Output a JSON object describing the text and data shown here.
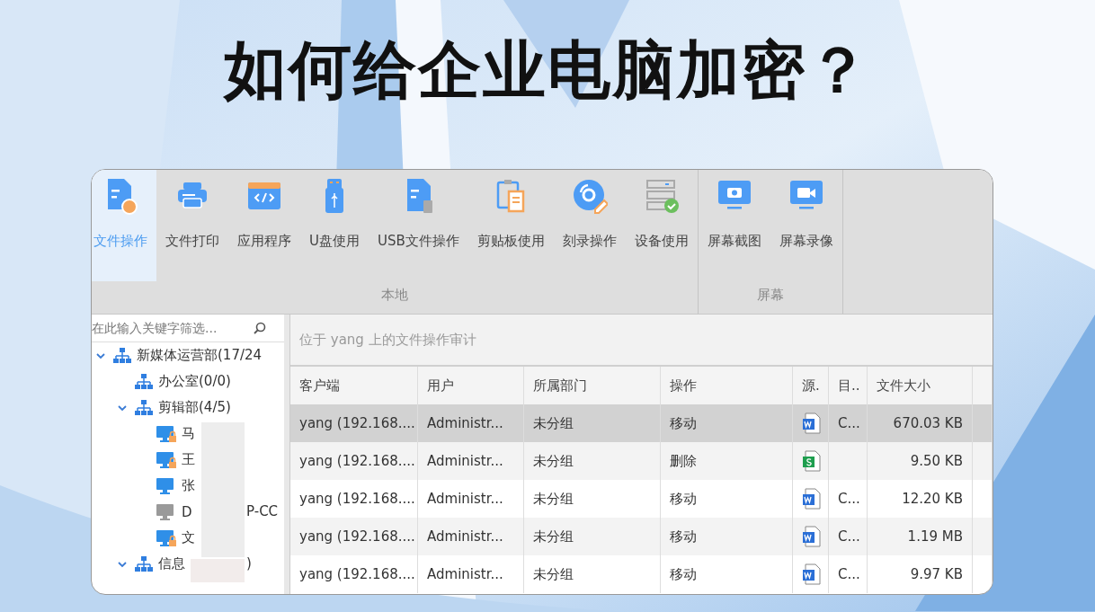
{
  "headline": "如何给企业电脑加密？",
  "toolbar": {
    "groups": [
      {
        "label": "本地",
        "items": [
          {
            "label": "文件操作",
            "kind": "file-op",
            "selected": true
          },
          {
            "label": "文件打印",
            "kind": "print",
            "selected": false
          },
          {
            "label": "应用程序",
            "kind": "app",
            "selected": false
          },
          {
            "label": "U盘使用",
            "kind": "usb",
            "selected": false
          },
          {
            "label": "USB文件操作",
            "kind": "usb-file",
            "selected": false
          },
          {
            "label": "剪贴板使用",
            "kind": "clipboard",
            "selected": false
          },
          {
            "label": "刻录操作",
            "kind": "disc",
            "selected": false
          },
          {
            "label": "设备使用",
            "kind": "device",
            "selected": false
          }
        ]
      },
      {
        "label": "屏幕",
        "items": [
          {
            "label": "屏幕截图",
            "kind": "screenshot",
            "selected": false
          },
          {
            "label": "屏幕录像",
            "kind": "record",
            "selected": false
          }
        ]
      }
    ]
  },
  "sidebar": {
    "search": {
      "placeholder": "在此输入关键字筛选..."
    },
    "tree": [
      {
        "kind": "group",
        "label": "新媒体运营部(17/24",
        "expanded": true,
        "children": [
          {
            "kind": "group",
            "label": "办公室(0/0)"
          },
          {
            "kind": "group",
            "label": "剪辑部(4/5)",
            "expanded": true,
            "children": [
              {
                "kind": "computer",
                "label": "马",
                "online": true,
                "locked": true
              },
              {
                "kind": "computer",
                "label": "王",
                "online": true,
                "locked": true
              },
              {
                "kind": "computer",
                "label": "张",
                "online": true,
                "locked": false
              },
              {
                "kind": "computer",
                "label": "D",
                "label_tail": "P-CC",
                "online": false,
                "locked": false
              },
              {
                "kind": "computer",
                "label": "文",
                "online": true,
                "locked": true
              }
            ]
          },
          {
            "kind": "group",
            "label": "信息",
            "label_tail": ")",
            "expanded": true
          }
        ]
      }
    ]
  },
  "panel": {
    "title": "位于 yang 上的文件操作审计",
    "table": {
      "columns": [
        "客户端",
        "用户",
        "所属部门",
        "操作",
        "源.",
        "目..",
        "文件大小"
      ],
      "rows": [
        {
          "client": "yang (192.168....",
          "user": "Administr...",
          "department": "未分组",
          "action": "移动",
          "source": {
            "kind": "word"
          },
          "target": "C...",
          "size": "670.03 KB",
          "selected": true
        },
        {
          "client": "yang (192.168....",
          "user": "Administr...",
          "department": "未分组",
          "action": "删除",
          "source": {
            "kind": "sheet"
          },
          "size": "9.50 KB",
          "selected": false
        },
        {
          "client": "yang (192.168....",
          "user": "Administr...",
          "department": "未分组",
          "action": "移动",
          "source": {
            "kind": "word"
          },
          "target": "C...",
          "size": "12.20 KB",
          "selected": false
        },
        {
          "client": "yang (192.168....",
          "user": "Administr...",
          "department": "未分组",
          "action": "移动",
          "source": {
            "kind": "word"
          },
          "target": "C...",
          "size": "1.19 MB",
          "selected": false
        },
        {
          "client": "yang (192.168....",
          "user": "Administr...",
          "department": "未分组",
          "action": "移动",
          "source": {
            "kind": "word"
          },
          "target": "C...",
          "size": "9.97 KB",
          "selected": false
        }
      ]
    }
  }
}
